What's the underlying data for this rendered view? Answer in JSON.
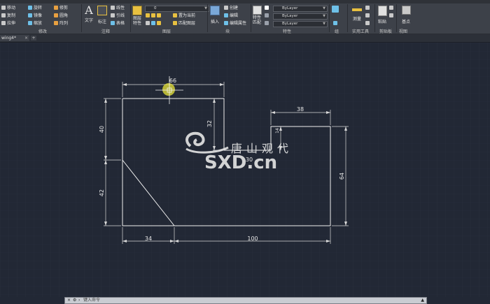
{
  "ribbon": {
    "modify": {
      "move": "移动",
      "rotate": "旋转",
      "copy": "复制",
      "mirror": "镜像",
      "stretch": "拉伸",
      "scale": "缩放",
      "trim": "修剪",
      "fillet": "圆角",
      "array": "阵列",
      "panel": "修改"
    },
    "annotation": {
      "text": "文字",
      "dimension": "标注",
      "linear": "线性",
      "leader": "引线",
      "table": "表格",
      "panel": "注释"
    },
    "layers": {
      "properties": "图层特性",
      "layer_value": "0",
      "make_current": "置为当前",
      "match": "匹配图层",
      "panel": "图层"
    },
    "block": {
      "insert": "插入",
      "create": "创建",
      "edit": "编辑",
      "edit_attributes": "编辑属性",
      "panel": "块"
    },
    "properties": {
      "match": "特性匹配",
      "color": "ByLayer",
      "linetype": "ByLayer",
      "lineweight": "ByLayer",
      "panel": "特性"
    },
    "groups": {
      "panel": "组"
    },
    "utilities": {
      "measure": "测量",
      "panel": "实用工具"
    },
    "clipboard": {
      "paste": "粘贴",
      "panel": "剪贴板"
    },
    "view": {
      "base": "基点",
      "panel": "视图"
    }
  },
  "doc_tab": {
    "name": "wing4*"
  },
  "dimensions": {
    "top_width": "66",
    "left_height": "40",
    "inner_height": "32",
    "small_height": "14",
    "notch_width": "38",
    "center": "30",
    "lower_left_height": "42",
    "right_height": "64",
    "bottom_left": "34",
    "bottom_right": "100"
  },
  "watermark": {
    "cn": "唐山观代",
    "en": "SXD.cn"
  },
  "command_line": {
    "placeholder": "键入命令"
  },
  "colors": {
    "canvas": "#222835",
    "ribbon": "#3d4149",
    "line": "#f0f0f0",
    "cursor": "#e8e43a"
  }
}
